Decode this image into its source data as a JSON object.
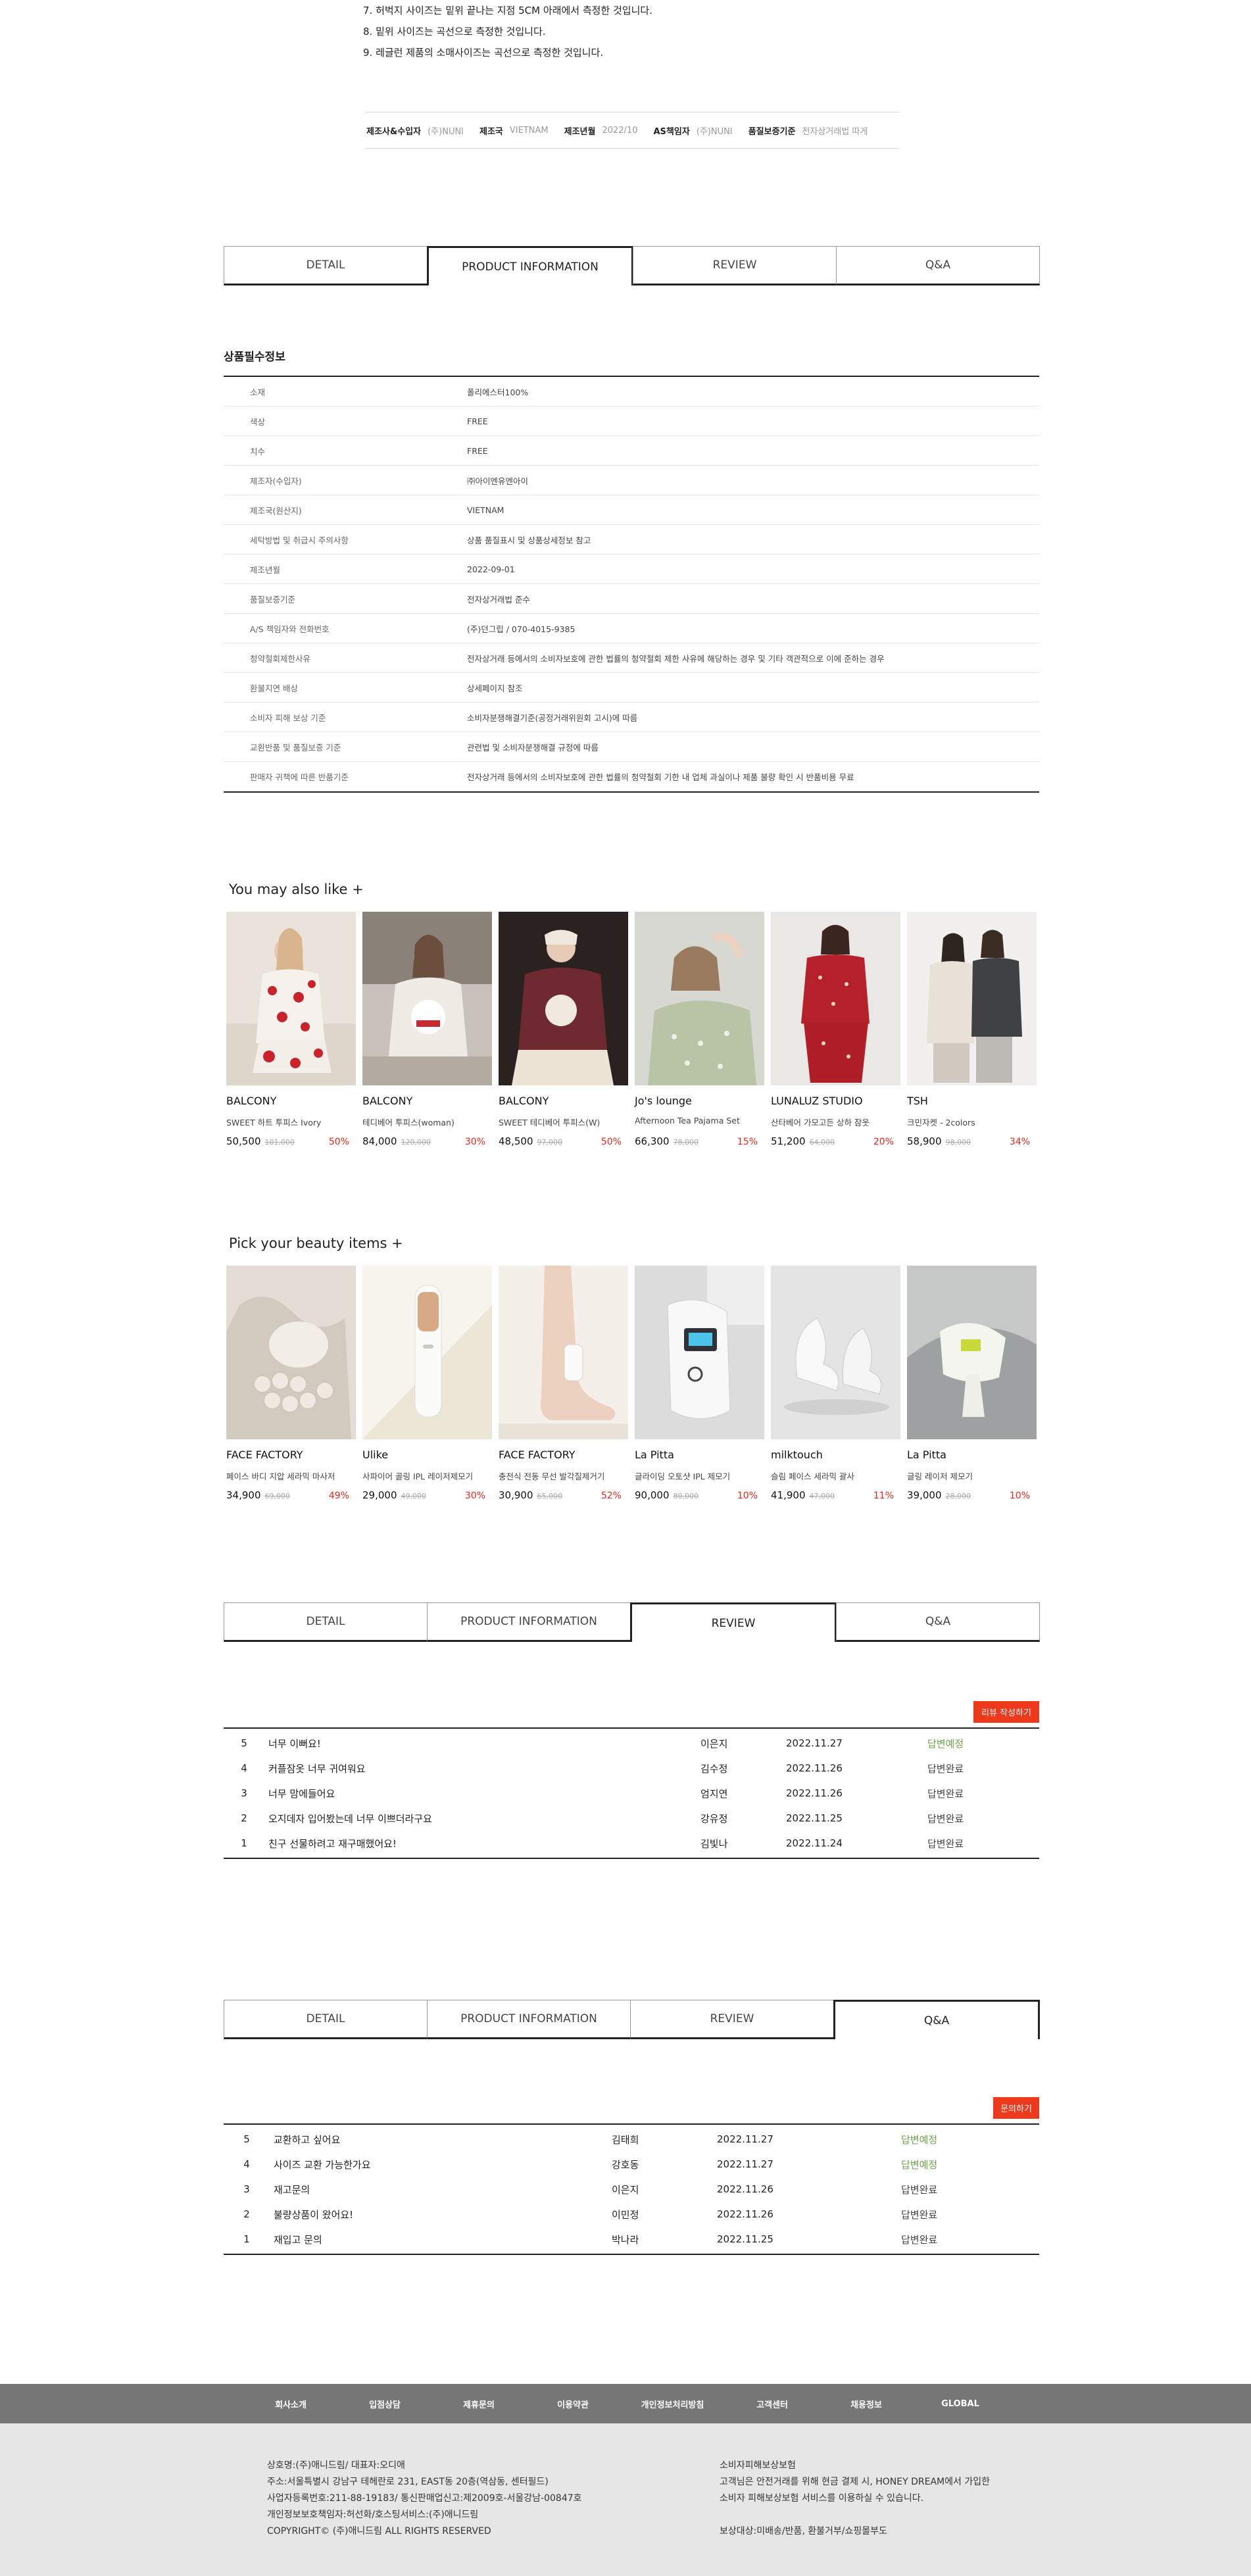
{
  "size_notes": [
    "7. 허벅지 사이즈는 밑위 끝나는 지점 5CM 아래에서 측정한 것입니다.",
    "8. 밑위 사이즈는 곡선으로 측정한 것입니다.",
    "9. 레글런 제품의 소매사이즈는 곡선으로 측정한 것입니다."
  ],
  "meta_bar": [
    {
      "key": "제조사&수입자",
      "value": "(주)NUNI"
    },
    {
      "key": "제조국",
      "value": "VIETNAM"
    },
    {
      "key": "제조년월",
      "value": "2022/10"
    },
    {
      "key": "AS책임자",
      "value": "(주)NUNI"
    },
    {
      "key": "품질보증기준",
      "value": "전자상거래법 따게"
    }
  ],
  "tabs": [
    "DETAIL",
    "PRODUCT INFORMATION",
    "REVIEW",
    "Q&A"
  ],
  "info": {
    "title": "상품필수정보",
    "rows": [
      {
        "label": "소재",
        "value": "폴리에스터100%"
      },
      {
        "label": "색상",
        "value": "FREE"
      },
      {
        "label": "치수",
        "value": "FREE"
      },
      {
        "label": "제조자(수입자)",
        "value": "㈜아이엔유엔아이"
      },
      {
        "label": "제조국(원산지)",
        "value": "VIETNAM"
      },
      {
        "label": "세탁방법 및 취급시 주의사항",
        "value": "상품 품질표시 및 상품상세정보 참고"
      },
      {
        "label": "제조년월",
        "value": "2022-09-01"
      },
      {
        "label": "품질보증기준",
        "value": "전자상거래법 준수"
      },
      {
        "label": "A/S 책임자와 전화번호",
        "value": "(주)던그립 / 070-4015-9385"
      },
      {
        "label": "청약철회제한사유",
        "value": "전자상거래 등에서의 소비자보호에 관한 법률의 청약철회 제한 사유에 해당하는 경우 및 기타 객관적으로 이에 준하는 경우"
      },
      {
        "label": "환불지연 배상",
        "value": "상세페이지 참조"
      },
      {
        "label": "소비자 피해 보상 기준",
        "value": "소비자분쟁해결기준(공정거래위원회 고시)에 따름"
      },
      {
        "label": "교환반품 및 품질보증 기준",
        "value": "관련법 및 소비자분쟁해결 규정에 따름"
      },
      {
        "label": "판매자 귀책에 따른 반품기준",
        "value": "전자상거래 등에서의 소비자보호에 관한 법률의 청약철회 기한 내 업체 과실이나 제품 불량 확인 시 반품비용 무료"
      }
    ]
  },
  "you_may_like": {
    "title": "You may also like +",
    "items": [
      {
        "brand": "BALCONY",
        "name": "SWEET 하트 투피스 Ivory",
        "price": "50,500",
        "orig": "101,000",
        "disc": "50%",
        "img": "pajama-hearts"
      },
      {
        "brand": "BALCONY",
        "name": "테디베어 투피스(woman)",
        "price": "84,000",
        "orig": "120,000",
        "disc": "30%",
        "img": "teddy-sweater"
      },
      {
        "brand": "BALCONY",
        "name": "SWEET 테디베어 투피스(W)",
        "price": "48,500",
        "orig": "97,000",
        "disc": "50%",
        "img": "teddy-burgundy"
      },
      {
        "brand": "Jo's lounge",
        "name": "Afternoon Tea Pajama Set",
        "price": "66,300",
        "orig": "78,000",
        "disc": "15%",
        "img": "floral-pajama"
      },
      {
        "brand": "LUNALUZ STUDIO",
        "name": "산타베어 가모고든 상하 잠옷",
        "price": "51,200",
        "orig": "64,000",
        "disc": "20%",
        "img": "red-pajama"
      },
      {
        "brand": "TSH",
        "name": "크민자켓 - 2colors",
        "price": "58,900",
        "orig": "98,000",
        "disc": "34%",
        "img": "jackets"
      }
    ]
  },
  "beauty": {
    "title": "Pick your beauty items +",
    "items": [
      {
        "brand": "FACE FACTORY",
        "name": "페이스 바디 지압 세라믹 마사저",
        "price": "34,900",
        "orig": "69,000",
        "disc": "49%",
        "img": "ceramic-massager"
      },
      {
        "brand": "Ulike",
        "name": "사파이어 골링 IPL 레이저제모기",
        "price": "29,000",
        "orig": "49,000",
        "disc": "30%",
        "img": "ipl-device"
      },
      {
        "brand": "FACE FACTORY",
        "name": "충전식 전동 무선 발각질제거기",
        "price": "30,900",
        "orig": "65,000",
        "disc": "52%",
        "img": "foot-file"
      },
      {
        "brand": "La Pitta",
        "name": "글라이딩 오토샷 IPL 제모기",
        "price": "90,000",
        "orig": "80,000",
        "disc": "10%",
        "img": "white-ipl"
      },
      {
        "brand": "milktouch",
        "name": "슬림 페이스 세라믹 괄사",
        "price": "41,900",
        "orig": "47,000",
        "disc": "11%",
        "img": "gua-sha"
      },
      {
        "brand": "La Pitta",
        "name": "글링 레이저 제모기",
        "price": "39,000",
        "orig": "28,000",
        "disc": "10%",
        "img": "laser-device"
      }
    ]
  },
  "review": {
    "write_label": "리뷰 작성하기",
    "rows": [
      {
        "no": "5",
        "subject": "너무 이뻐요!",
        "author": "이은지",
        "date": "2022.11.27",
        "status": "답변예정",
        "wait": true
      },
      {
        "no": "4",
        "subject": "커플잠옷 너무 귀여워요",
        "author": "김수정",
        "date": "2022.11.26",
        "status": "답변완료",
        "wait": false
      },
      {
        "no": "3",
        "subject": "너무 맘에들어요",
        "author": "엄지연",
        "date": "2022.11.26",
        "status": "답변완료",
        "wait": false
      },
      {
        "no": "2",
        "subject": "오지데자 입어봤는데 너무 이쁘더라구요",
        "author": "강유정",
        "date": "2022.11.25",
        "status": "답변완료",
        "wait": false
      },
      {
        "no": "1",
        "subject": "친구 선물하려고 재구매했어요!",
        "author": "김빛나",
        "date": "2022.11.24",
        "status": "답변완료",
        "wait": false
      }
    ]
  },
  "qna": {
    "write_label": "문의하기",
    "rows": [
      {
        "no": "5",
        "subject": "교환하고 싶어요",
        "author": "김태희",
        "date": "2022.11.27",
        "status": "답변예정",
        "wait": true
      },
      {
        "no": "4",
        "subject": "사이즈 교환 가능한가요",
        "author": "강호동",
        "date": "2022.11.27",
        "status": "답변예정",
        "wait": true
      },
      {
        "no": "3",
        "subject": "재고문의",
        "author": "이은지",
        "date": "2022.11.26",
        "status": "답변완료",
        "wait": false
      },
      {
        "no": "2",
        "subject": "불량상품이 왔어요!",
        "author": "이민정",
        "date": "2022.11.26",
        "status": "답변완료",
        "wait": false
      },
      {
        "no": "1",
        "subject": "재입고 문의",
        "author": "박나라",
        "date": "2022.11.25",
        "status": "답변완료",
        "wait": false
      }
    ]
  },
  "footer": {
    "nav": [
      "회사소개",
      "입점상담",
      "제휴문의",
      "이용약관",
      "개인정보처리방침",
      "고객센터",
      "채용정보",
      "GLOBAL"
    ],
    "company": [
      "상호명:(주)애니드림/ 대표자:오디애",
      "주소:서울특별시 강남구 테헤란로 231, EAST동 20층(역삼동, 센터필드)",
      "사업자등록번호:211-88-19183/ 통신판매업신고:제2009호-서울강남-00847호",
      "개인정보보호책임자:허선화/호스팅서비스:(주)애니드림",
      "COPYRIGHT© (주)애니드림 ALL RIGHTS RESERVED"
    ],
    "consumer": [
      "소비자피해보상보험",
      "고객님은 안전거래를 위해 현금 결제 시, HONEY DREAM에서 가입한",
      "소비자 피해보상보험 서비스를 이용하실 수 있습니다.",
      "",
      "보상대상:미배송/반품, 환불거부/쇼핑몰부도"
    ]
  },
  "colors": {
    "accent": "#ee3a1c",
    "discount": "#e8271c",
    "waiting": "#6aa64a",
    "footer_nav": "#767676",
    "footer_info": "#e6e6e6"
  }
}
